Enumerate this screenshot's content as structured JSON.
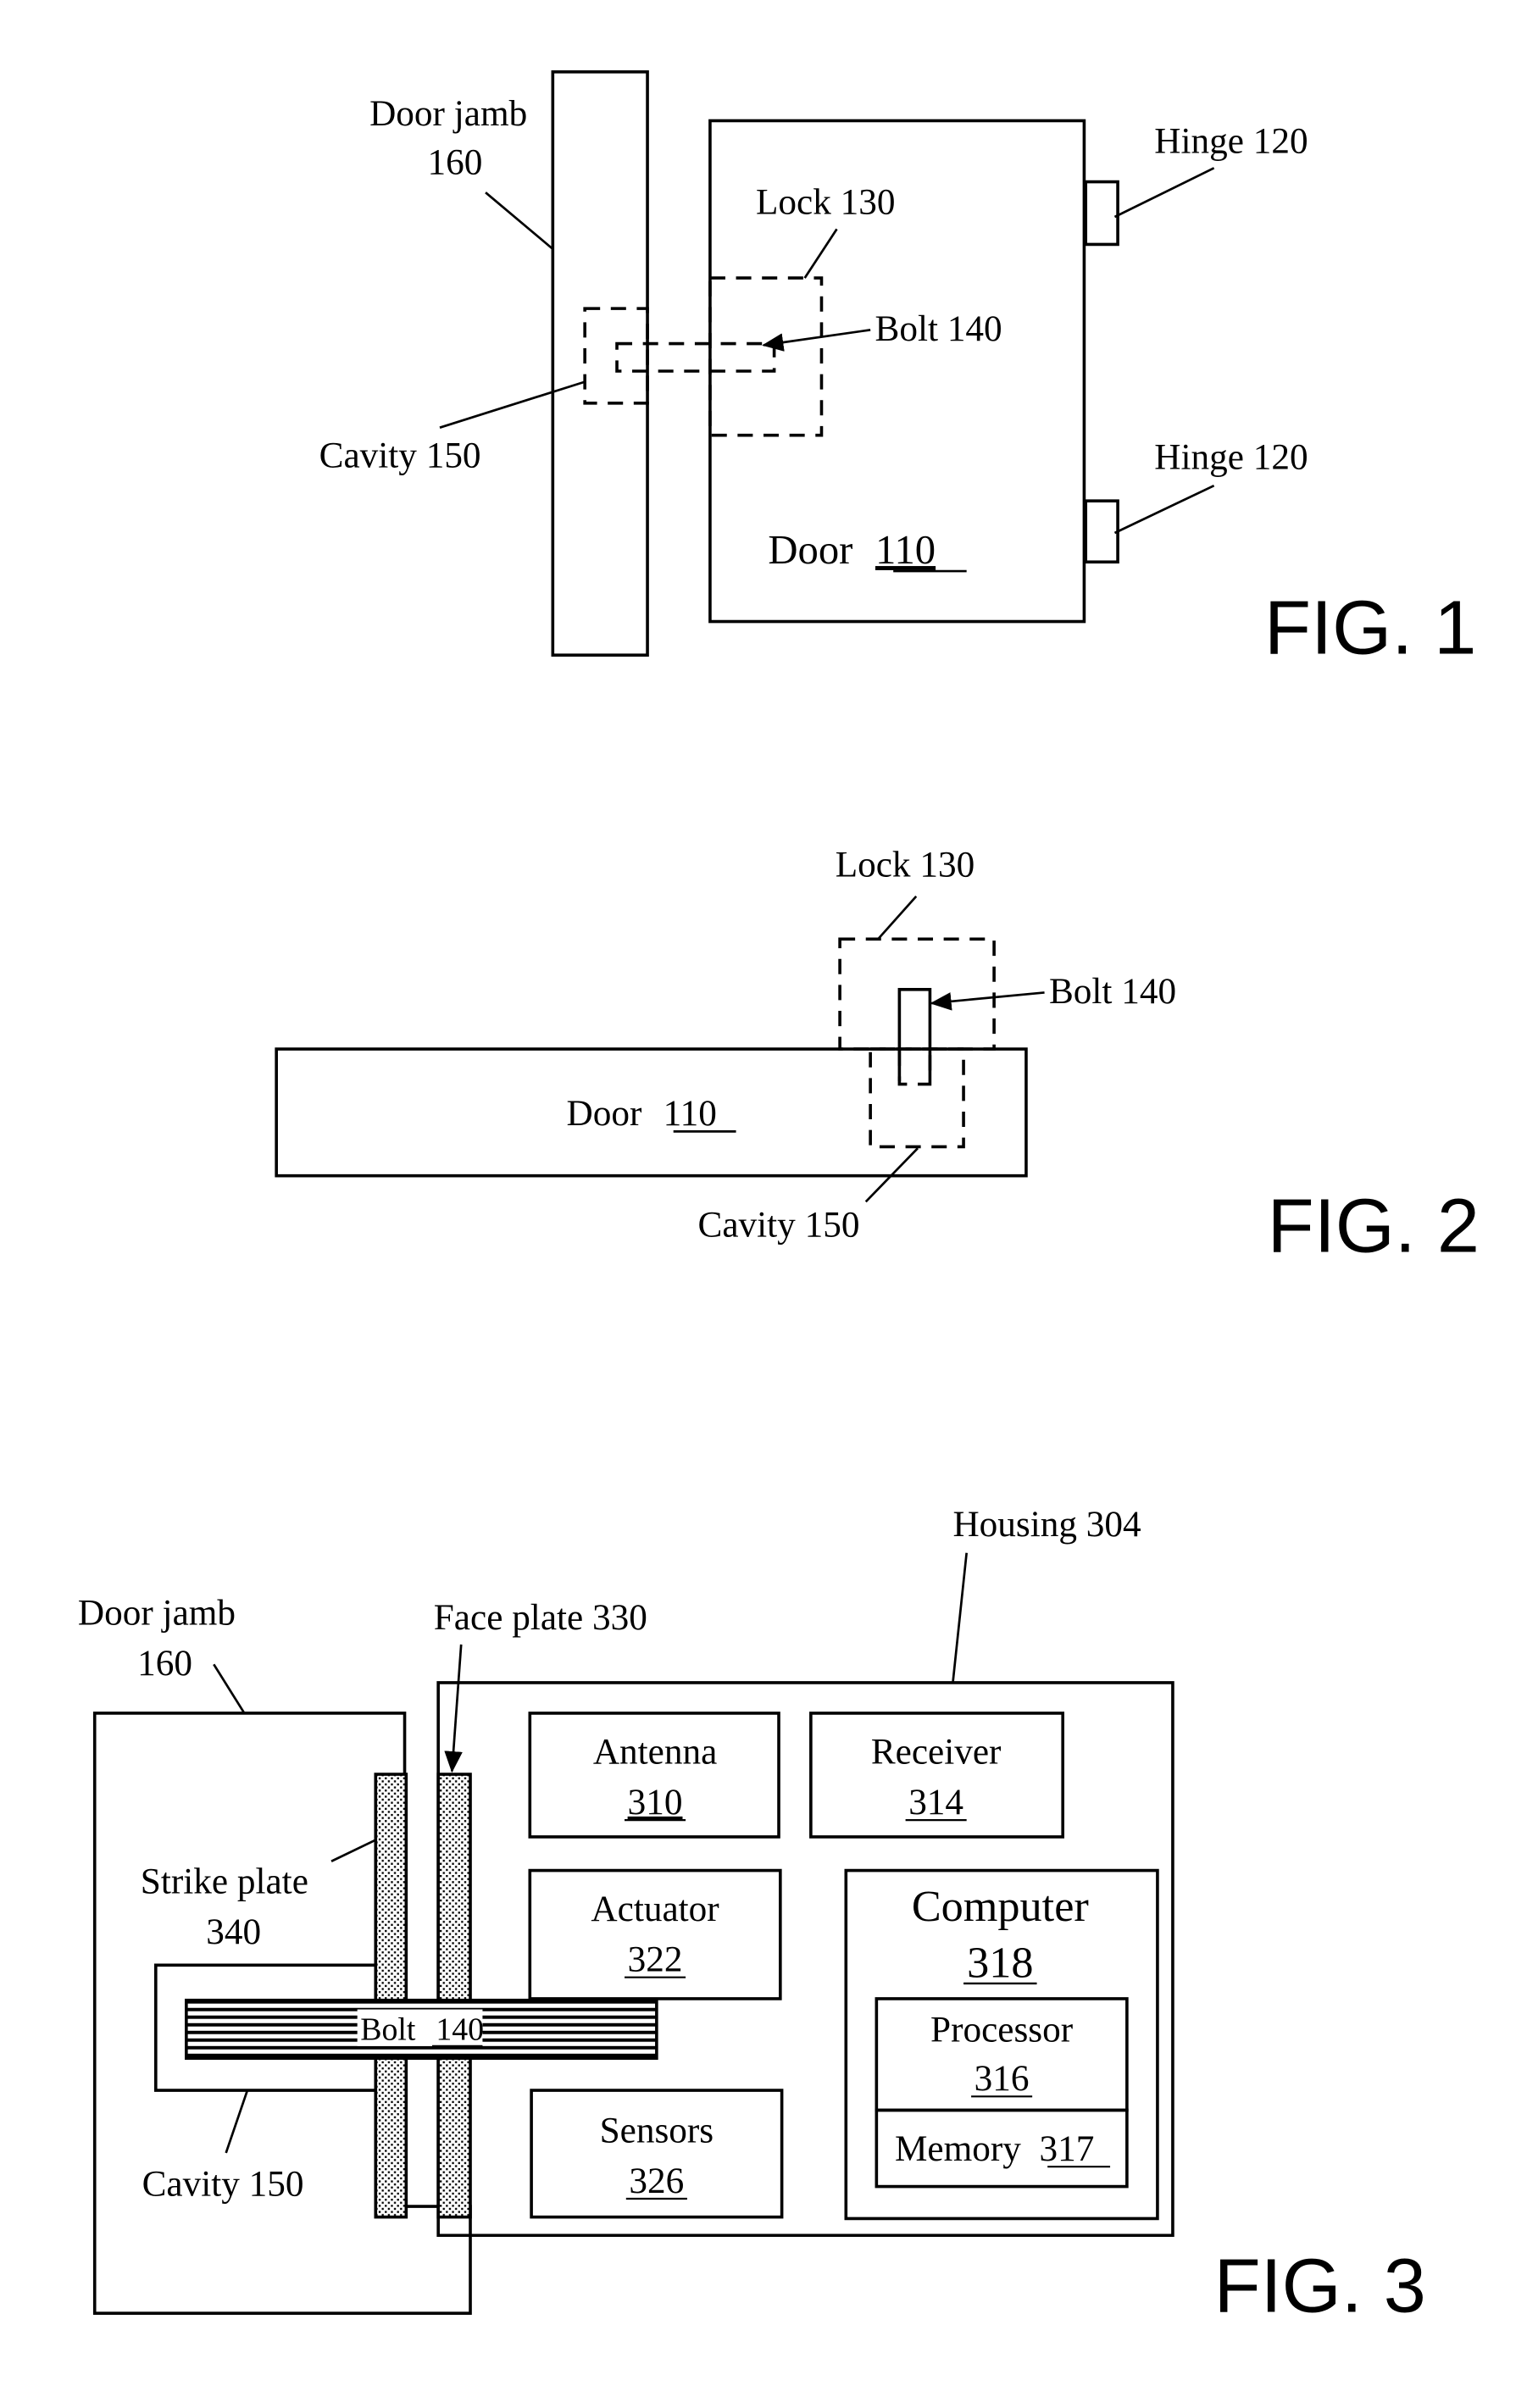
{
  "fig1": {
    "figure_label": "FIG. 1",
    "door_jamb_line1": "Door jamb",
    "door_jamb_line2": "160",
    "lock": "Lock 130",
    "bolt": "Bolt 140",
    "cavity": "Cavity 150",
    "hinge_top": "Hinge 120",
    "hinge_bottom": "Hinge 120",
    "door_word": "Door",
    "door_num": "110"
  },
  "fig2": {
    "figure_label": "FIG. 2",
    "lock": "Lock 130",
    "bolt": "Bolt 140",
    "cavity": "Cavity 150",
    "door_word": "Door",
    "door_num": "110"
  },
  "fig3": {
    "figure_label": "FIG. 3",
    "housing": "Housing 304",
    "door_jamb_line1": "Door jamb",
    "door_jamb_line2": "160",
    "face_plate": "Face plate 330",
    "strike_plate_line1": "Strike plate",
    "strike_plate_line2": "340",
    "cavity": "Cavity 150",
    "bolt_word": "Bolt",
    "bolt_num": "140",
    "antenna_word": "Antenna",
    "antenna_num": "310",
    "receiver_word": "Receiver",
    "receiver_num": "314",
    "actuator_word": "Actuator",
    "actuator_num": "322",
    "computer_word": "Computer",
    "computer_num": "318",
    "processor_word": "Processor",
    "processor_num": "316",
    "memory_word": "Memory",
    "memory_num": "317",
    "sensors_word": "Sensors",
    "sensors_num": "326"
  }
}
